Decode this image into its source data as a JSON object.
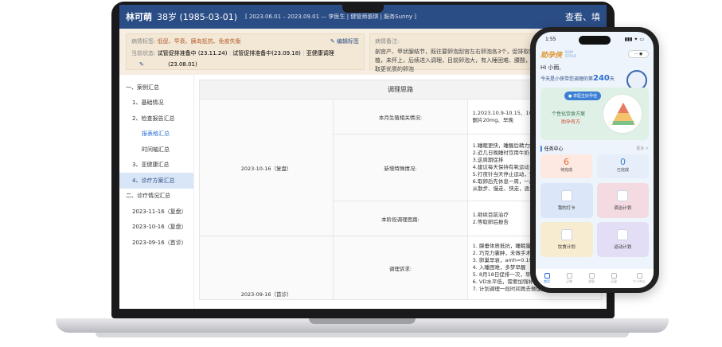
{
  "laptop": {
    "header": {
      "name": "林可萌",
      "age": "38岁 (1985-03-01)",
      "period": "[ 2023.06.01 – 2023.09.01 — 李医生 | 健管师張琪 | 服务Sunny ]",
      "more": "查看、填"
    },
    "info": {
      "tags_label": "病情标签:",
      "tags": "低促、早衰、胰岛抵抗、免疫失衡",
      "edit_label": "编辑标签",
      "status_label": "当前状态:",
      "status_lines": [
        "试管促排准备中 (23.11.24)",
        "试管促排准备中(23.09.18)",
        "亚健康调理",
        "(23.08.01)"
      ],
      "remark_label": "病情备注:",
      "remark_text": "剖宫产、甲状腺结节，既往要卵泡刮宫左右卵泡各3个，促排取卵获得3个卵，做过一次移植，未怀上，后续进入调理，目前卵泡大，有入睡困难、腰酸，特别在排卵期，想养卵获取更优质的卵泡"
    },
    "sidebar": {
      "items": [
        {
          "label": "一、案例汇总",
          "level": 1
        },
        {
          "label": "1、基础情况",
          "level": 2
        },
        {
          "label": "2、检查报告汇总",
          "level": 2
        },
        {
          "label": "报表格汇总",
          "level": 3,
          "link": true
        },
        {
          "label": "时间轴汇总",
          "level": 3
        },
        {
          "label": "3、亚健康汇总",
          "level": 2
        },
        {
          "label": "4、诊疗方案汇总",
          "level": 2,
          "active": true
        },
        {
          "label": "二、诊疗情况汇总",
          "level": 1
        },
        {
          "label": "2023-11-16（复盘）",
          "level": 2
        },
        {
          "label": "2023-10-16（复盘）",
          "level": 2
        },
        {
          "label": "2023-09-16（首诊）",
          "level": 2
        }
      ]
    },
    "plan": {
      "title": "调理思路",
      "rows": [
        {
          "date": "2023-10-16（复盘）",
          "key": "本月生殖相关情况:",
          "value": "1.2023.10.9-10.15、10.10 HMG300IU*8+地区孕酮片20mg、早晚"
        },
        {
          "date": "",
          "key": "新增特殊情况:",
          "value": "1.睡眠更快，睡醒后精力好\n2.近几日晚睡时饮用牛奶，导致起夜\n3.这周期促排\n4.建议每天保持有氧运动，可以是散步或快走的方式\n5.打夜针当天停止运动，安心等待取卵\n6.取卵后先休息一周，一周后身体无任何不适，可以从散步、慢走、快走，逐步恢复运动"
        },
        {
          "date": "",
          "key": "本阶段调理思路:",
          "value": "1.继续目前治疗\n2.等取卵后报告"
        },
        {
          "date": "2023-09-16（首诊）",
          "key": "调理诉求:",
          "value": "1.  腺垂体质抵抗，睡眠量异常\n2.  巧克力囊肿，未做手术\n3.  卵巢早衰，amh=0.19\n4.  入睡困难，多梦早醒\n5.  8月18日促排一次，早排没取到卵\n6.  VD水平低，需要加强补充，每天4000iu\n7.  计划调理一段时间再去做促排"
        }
      ]
    }
  },
  "phone": {
    "status": {
      "time": "1:55",
      "signal": "▮▮▮ ✦ ▭"
    },
    "app_name": "助孕侠",
    "app_name_sub": "BABY\nSTRIVE",
    "capsule": "··· ◉",
    "greeting": "Hi 小雨,",
    "days_prefix": "今天是小侠带您调理的第",
    "days_count": "240",
    "days_suffix": "天",
    "banner": {
      "pill": "● 李医生好孕佳",
      "line1": "个性化饮食方案",
      "line2": "助孕有方"
    },
    "tasks": {
      "title": "任务中心",
      "more": "更多 >",
      "pending": {
        "count": "6",
        "label": "待完成"
      },
      "done": {
        "count": "0",
        "label": "已完成"
      }
    },
    "tiles": [
      {
        "label": "我的打卡"
      },
      {
        "label": "调治计划"
      },
      {
        "label": "饮食计划"
      },
      {
        "label": "运动计划"
      }
    ],
    "tabbar": [
      "首页",
      "订单",
      "消息",
      "记录",
      "个人中心"
    ]
  }
}
